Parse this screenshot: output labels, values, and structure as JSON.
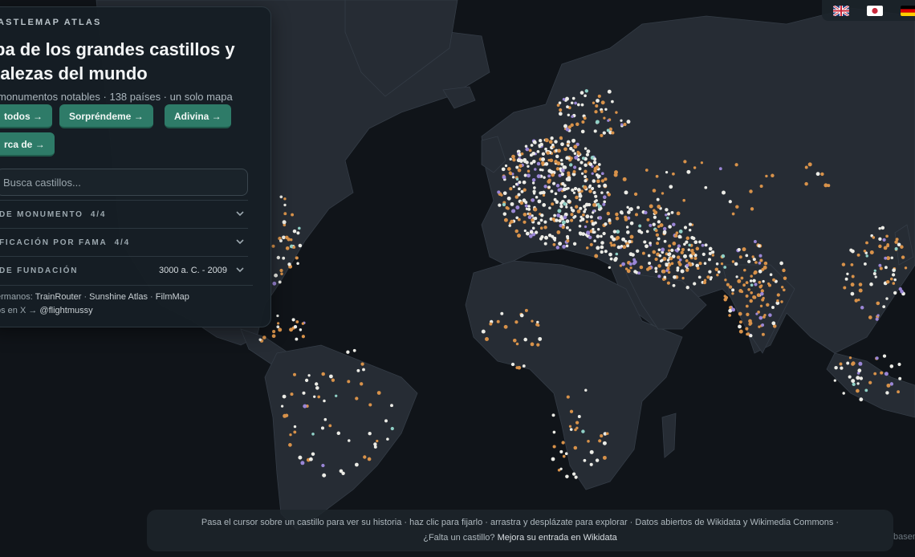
{
  "app": {
    "brand": "ASTLEMAP ATLAS",
    "title": "pa de los grandes castillos y talezas del mundo",
    "subtitle": "monumentos notables · 138 países · un solo mapa"
  },
  "buttons": {
    "all": " todos →",
    "surprise": "Sorpréndeme →",
    "guess": "Adivina →",
    "near": "rca de →"
  },
  "search": {
    "placeholder": "Busca castillos..."
  },
  "filters": [
    {
      "label": " DE MONUMENTO",
      "count": "4/4",
      "value": ""
    },
    {
      "label": "FICACIÓN POR FAMA",
      "count": "4/4",
      "value": ""
    },
    {
      "label": " DE FUNDACIÓN",
      "count": "",
      "value": "3000 a. C. - 2009"
    }
  ],
  "links": {
    "siblings_prefix": "ermanos:",
    "sibling_1": "TrainRouter",
    "sibling_2": "Sunshine Atlas",
    "sibling_3": "FilmMap",
    "social_prefix": "os en X →",
    "social_handle": "@flightmussy"
  },
  "languages": [
    {
      "name": "English",
      "icon": "flag-uk-icon"
    },
    {
      "name": "日本語",
      "icon": "flag-japan-icon"
    },
    {
      "name": "Deutsch",
      "icon": "flag-germany-icon"
    }
  ],
  "footer": {
    "line1": "Pasa el cursor sobre un castillo para ver su historia · haz clic para fijarlo · arrastra y desplázate para explorar · Datos abiertos de Wikidata y Wikimedia Commons ·",
    "line2_prefix": "¿Falta un castillo?",
    "line2_link": "Mejora su entrada en Wikidata",
    "basemap": "basem"
  },
  "colors": {
    "background": "#101419",
    "land": "#272d35",
    "accent_button": "#2e7b68",
    "marker_white": "#ecece6",
    "marker_orange": "#d8924a",
    "marker_purple": "#9a86d6",
    "marker_teal": "#8fd0c6"
  }
}
